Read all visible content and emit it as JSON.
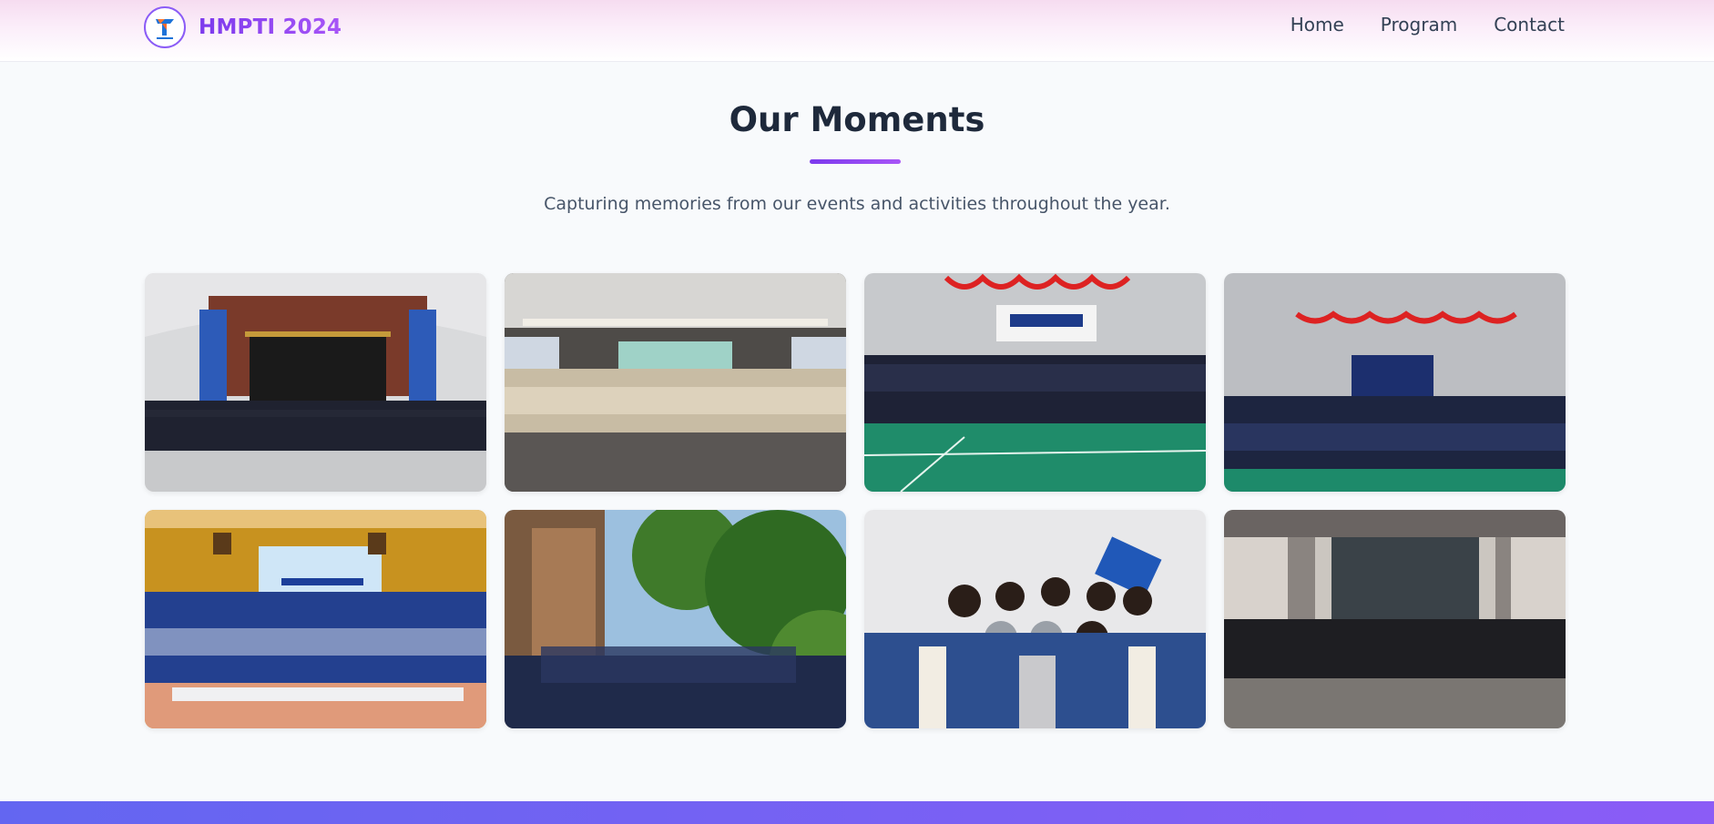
{
  "brand": {
    "name": "HMPTI 2024",
    "logo_icon": "hmpti-logo-icon"
  },
  "nav": {
    "home": "Home",
    "program": "Program",
    "contact": "Contact"
  },
  "section": {
    "title": "Our Moments",
    "subtitle": "Capturing memories from our events and activities throughout the year."
  },
  "gallery": [
    {
      "icon": "group-photo-auditorium"
    },
    {
      "icon": "group-photo-hall-stage"
    },
    {
      "icon": "group-photo-lkmm-td-2024"
    },
    {
      "icon": "group-photo-upgrading"
    },
    {
      "icon": "group-photo-wood-hall"
    },
    {
      "icon": "group-photo-outdoor-garden"
    },
    {
      "icon": "group-photo-varsity-jackets"
    },
    {
      "icon": "group-photo-building-steps"
    }
  ],
  "colors": {
    "accent": "#7c3aed",
    "accent2": "#a855f7",
    "footer_start": "#6366f1",
    "footer_end": "#8b5cf6"
  }
}
